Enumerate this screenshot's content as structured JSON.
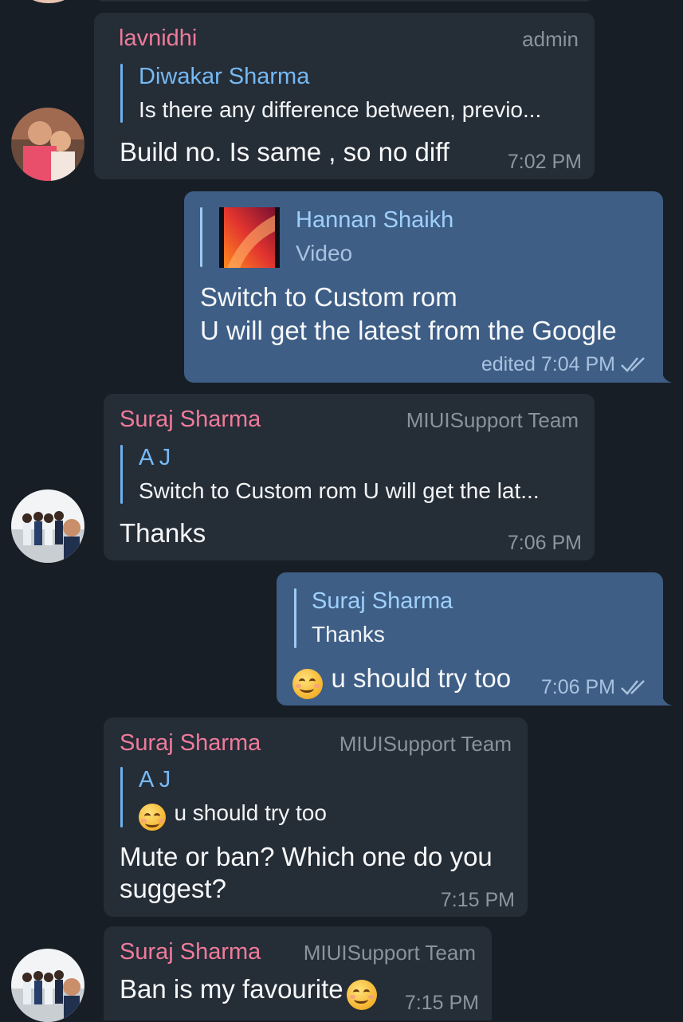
{
  "messages": [
    {
      "sender": "lavnidhi",
      "role": "admin",
      "reply_name": "Diwakar Sharma",
      "reply_text": "Is there any difference between, previo...",
      "text": "Build no. Is same , so no diff",
      "time": "7:02 PM"
    },
    {
      "reply_name": "Hannan Shaikh",
      "reply_text": "Video",
      "text_line1": "Switch to Custom rom",
      "text_line2": "U will get the latest from the  Google",
      "time": "edited 7:04 PM"
    },
    {
      "sender": "Suraj Sharma",
      "role": "MIUISupport Team",
      "reply_name": "A J",
      "reply_text": "Switch to Custom rom U will get the lat...",
      "text": "Thanks",
      "time": "7:06 PM"
    },
    {
      "reply_name": "Suraj Sharma",
      "reply_text": "Thanks",
      "text": "u should try too",
      "time": "7:06 PM"
    },
    {
      "sender": "Suraj Sharma",
      "role": "MIUISupport Team",
      "reply_name": "A J",
      "reply_text": "u should try too",
      "text_line1": "Mute or ban? Which one do you",
      "text_line2": "suggest?",
      "time": "7:15 PM"
    },
    {
      "sender": "Suraj Sharma",
      "role": "MIUISupport Team",
      "text": "Ban is my favourite",
      "time": "7:15 PM"
    }
  ],
  "colors": {
    "background": "#181e26",
    "incoming_bubble": "#252d37",
    "outgoing_bubble": "#3e5e86",
    "sender_name": "#ee7b9a",
    "reply_accent": "#76b9f4"
  },
  "icons": [
    "double-check-icon",
    "smile-emoji-icon",
    "video-thumbnail",
    "avatar"
  ]
}
